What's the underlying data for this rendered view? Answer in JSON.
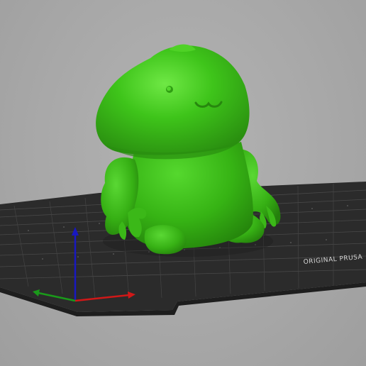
{
  "viewport": {
    "background_color": "#a9a9a9",
    "bed_color": "#2b2b2b",
    "bed_grid_color": "#4a4a4a",
    "model_color": "#3ec41a",
    "model_shadow_color": "#2a8f10",
    "model_highlight_color": "#62e23a"
  },
  "bed": {
    "label": "ORIGINAL PRUSA"
  },
  "axes": {
    "x_color": "#d01818",
    "y_color": "#1a9a1a",
    "z_color": "#1818c0"
  },
  "model": {
    "name": "green-creature-model"
  }
}
